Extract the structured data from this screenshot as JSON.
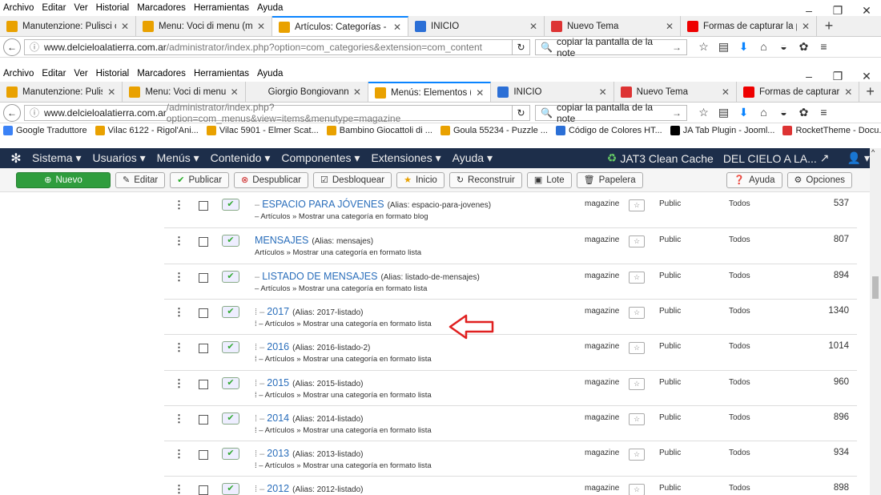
{
  "outer_window": {
    "menu": [
      "Archivo",
      "Editar",
      "Ver",
      "Historial",
      "Marcadores",
      "Herramientas",
      "Ayuda"
    ],
    "tabs": [
      {
        "title": "Manutenzione: Pulisci cac...",
        "active": false
      },
      {
        "title": "Menu: Voci di menu (mai...",
        "active": false
      },
      {
        "title": "Artículos: Categorías - DE...",
        "active": true
      },
      {
        "title": "INICIO",
        "active": false
      },
      {
        "title": "Nuevo Tema",
        "active": false
      },
      {
        "title": "Formas de capturar la pan...",
        "active": false
      }
    ],
    "url_host": "www.delcieloalatierra.com.ar",
    "url_path": "/administrator/index.php?option=com_categories&extension=com_content",
    "search": "copiar la pantalla de la note"
  },
  "inner_window": {
    "menu": [
      "Archivo",
      "Editar",
      "Ver",
      "Historial",
      "Marcadores",
      "Herramientas",
      "Ayuda"
    ],
    "tabs": [
      {
        "title": "Manutenzione: Pulisc...",
        "active": false
      },
      {
        "title": "Menu: Voci di menu (...",
        "active": false
      },
      {
        "title": "Giorgio Bongiovanni",
        "active": false
      },
      {
        "title": "Menús: Elementos (...",
        "active": true
      },
      {
        "title": "INICIO",
        "active": false
      },
      {
        "title": "Nuevo Tema",
        "active": false
      },
      {
        "title": "Formas de capturar la...",
        "active": false
      }
    ],
    "url_host": "www.delcieloalatierra.com.ar",
    "url_path": "/administrator/index.php?option=com_menus&view=items&menutype=magazine",
    "search": "copiar la pantalla de la note",
    "bookmarks": [
      "Google Traduttore",
      "Vilac 6122 - Rigol'Ani...",
      "Vilac 5901 - Elmer Scat...",
      "Bambino Giocattoli di ...",
      "Goula 55234 - Puzzle ...",
      "Código de Colores HT...",
      "JA Tab Plugin - Jooml...",
      "RocketTheme - Docu..."
    ]
  },
  "joomla_nav": {
    "items": [
      "Sistema ▾",
      "Usuarios ▾",
      "Menús ▾",
      "Contenido ▾",
      "Componentes ▾",
      "Extensiones ▾",
      "Ayuda ▾"
    ],
    "cache": "JAT3 Clean Cache",
    "site": "DEL CIELO A LA...",
    "user": "▾"
  },
  "toolbar": {
    "nuevo": "Nuevo",
    "editar": "Editar",
    "publicar": "Publicar",
    "despublicar": "Despublicar",
    "desbloquear": "Desbloquear",
    "inicio": "Inicio",
    "reconstruir": "Reconstruir",
    "lote": "Lote",
    "papelera": "Papelera",
    "ayuda": "Ayuda",
    "opciones": "Opciones"
  },
  "rows": [
    {
      "prefix": "– ",
      "title": "ESPACIO PARA JÓVENES",
      "alias": "(Alias: espacio-para-jovenes)",
      "type": "– Artículos » Mostrar una categoría en formato blog",
      "menu": "magazine",
      "access": "Public",
      "lang": "Todos",
      "id": "537"
    },
    {
      "prefix": "",
      "title": "MENSAJES",
      "alias": "(Alias: mensajes)",
      "type": "Artículos » Mostrar una categoría en formato lista",
      "menu": "magazine",
      "access": "Public",
      "lang": "Todos",
      "id": "807"
    },
    {
      "prefix": "– ",
      "title": "LISTADO DE MENSAJES",
      "alias": "(Alias: listado-de-mensajes)",
      "type": "– Artículos » Mostrar una categoría en formato lista",
      "menu": "magazine",
      "access": "Public",
      "lang": "Todos",
      "id": "894"
    },
    {
      "prefix": "⁞  – ",
      "title": "2017",
      "alias": "(Alias: 2017-listado)",
      "type": "⁞  – Artículos » Mostrar una categoría en formato lista",
      "menu": "magazine",
      "access": "Public",
      "lang": "Todos",
      "id": "1340"
    },
    {
      "prefix": "⁞  – ",
      "title": "2016",
      "alias": "(Alias: 2016-listado-2)",
      "type": "⁞  – Artículos » Mostrar una categoría en formato lista",
      "menu": "magazine",
      "access": "Public",
      "lang": "Todos",
      "id": "1014"
    },
    {
      "prefix": "⁞  – ",
      "title": "2015",
      "alias": "(Alias: 2015-listado)",
      "type": "⁞  – Artículos » Mostrar una categoría en formato lista",
      "menu": "magazine",
      "access": "Public",
      "lang": "Todos",
      "id": "960"
    },
    {
      "prefix": "⁞  – ",
      "title": "2014",
      "alias": "(Alias: 2014-listado)",
      "type": "⁞  – Artículos » Mostrar una categoría en formato lista",
      "menu": "magazine",
      "access": "Public",
      "lang": "Todos",
      "id": "896"
    },
    {
      "prefix": "⁞  – ",
      "title": "2013",
      "alias": "(Alias: 2013-listado)",
      "type": "⁞  – Artículos » Mostrar una categoría en formato lista",
      "menu": "magazine",
      "access": "Public",
      "lang": "Todos",
      "id": "934"
    },
    {
      "prefix": "⁞  – ",
      "title": "2012",
      "alias": "(Alias: 2012-listado)",
      "type": "",
      "menu": "magazine",
      "access": "Public",
      "lang": "Todos",
      "id": "898"
    }
  ],
  "colors": {
    "accent": "#2a6ebb",
    "nav_bg": "#1d2e4a",
    "new_btn": "#2f9d3d",
    "annotation": "#e02020"
  }
}
